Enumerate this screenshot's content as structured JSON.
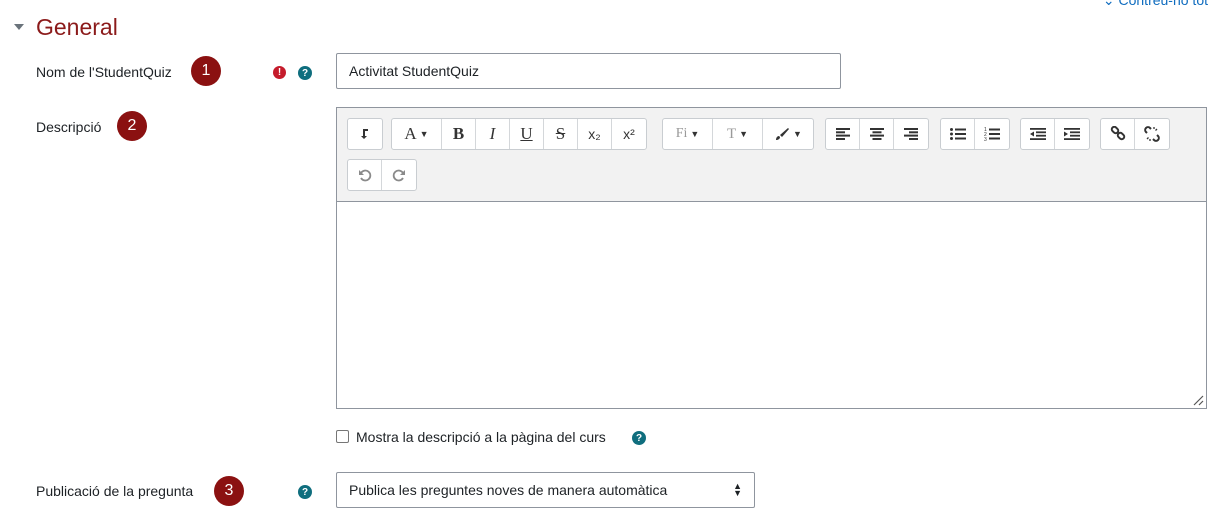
{
  "header": {
    "collapse_all": "Contreu-ho tot",
    "section_title": "General"
  },
  "fields": {
    "name": {
      "label": "Nom de l'StudentQuiz",
      "badge": "1",
      "required_icon": "exclamation-circle",
      "help_icon": "question-circle",
      "value": "Activitat StudentQuiz"
    },
    "description": {
      "label": "Descripció",
      "badge": "2",
      "value": "",
      "show_on_course": {
        "label": "Mostra la descripció a la pàgina del curs",
        "checked": false,
        "help_icon": "question-circle"
      }
    },
    "publish": {
      "label": "Publicació de la pregunta",
      "badge": "3",
      "help_icon": "question-circle",
      "selected": "Publica les preguntes noves de manera automàtica"
    }
  },
  "toolbar": {
    "bold": "B",
    "italic": "I",
    "underline": "U",
    "strike": "S",
    "subscript": "x₂",
    "superscript": "x²",
    "font_style": "A",
    "font_family": "Fi",
    "font_size": "T"
  },
  "colors": {
    "section_title": "#8b1a1a",
    "badge": "#8b1111",
    "required": "#c51c2c",
    "help": "#0f6e7e",
    "link": "#0f6cbf"
  }
}
